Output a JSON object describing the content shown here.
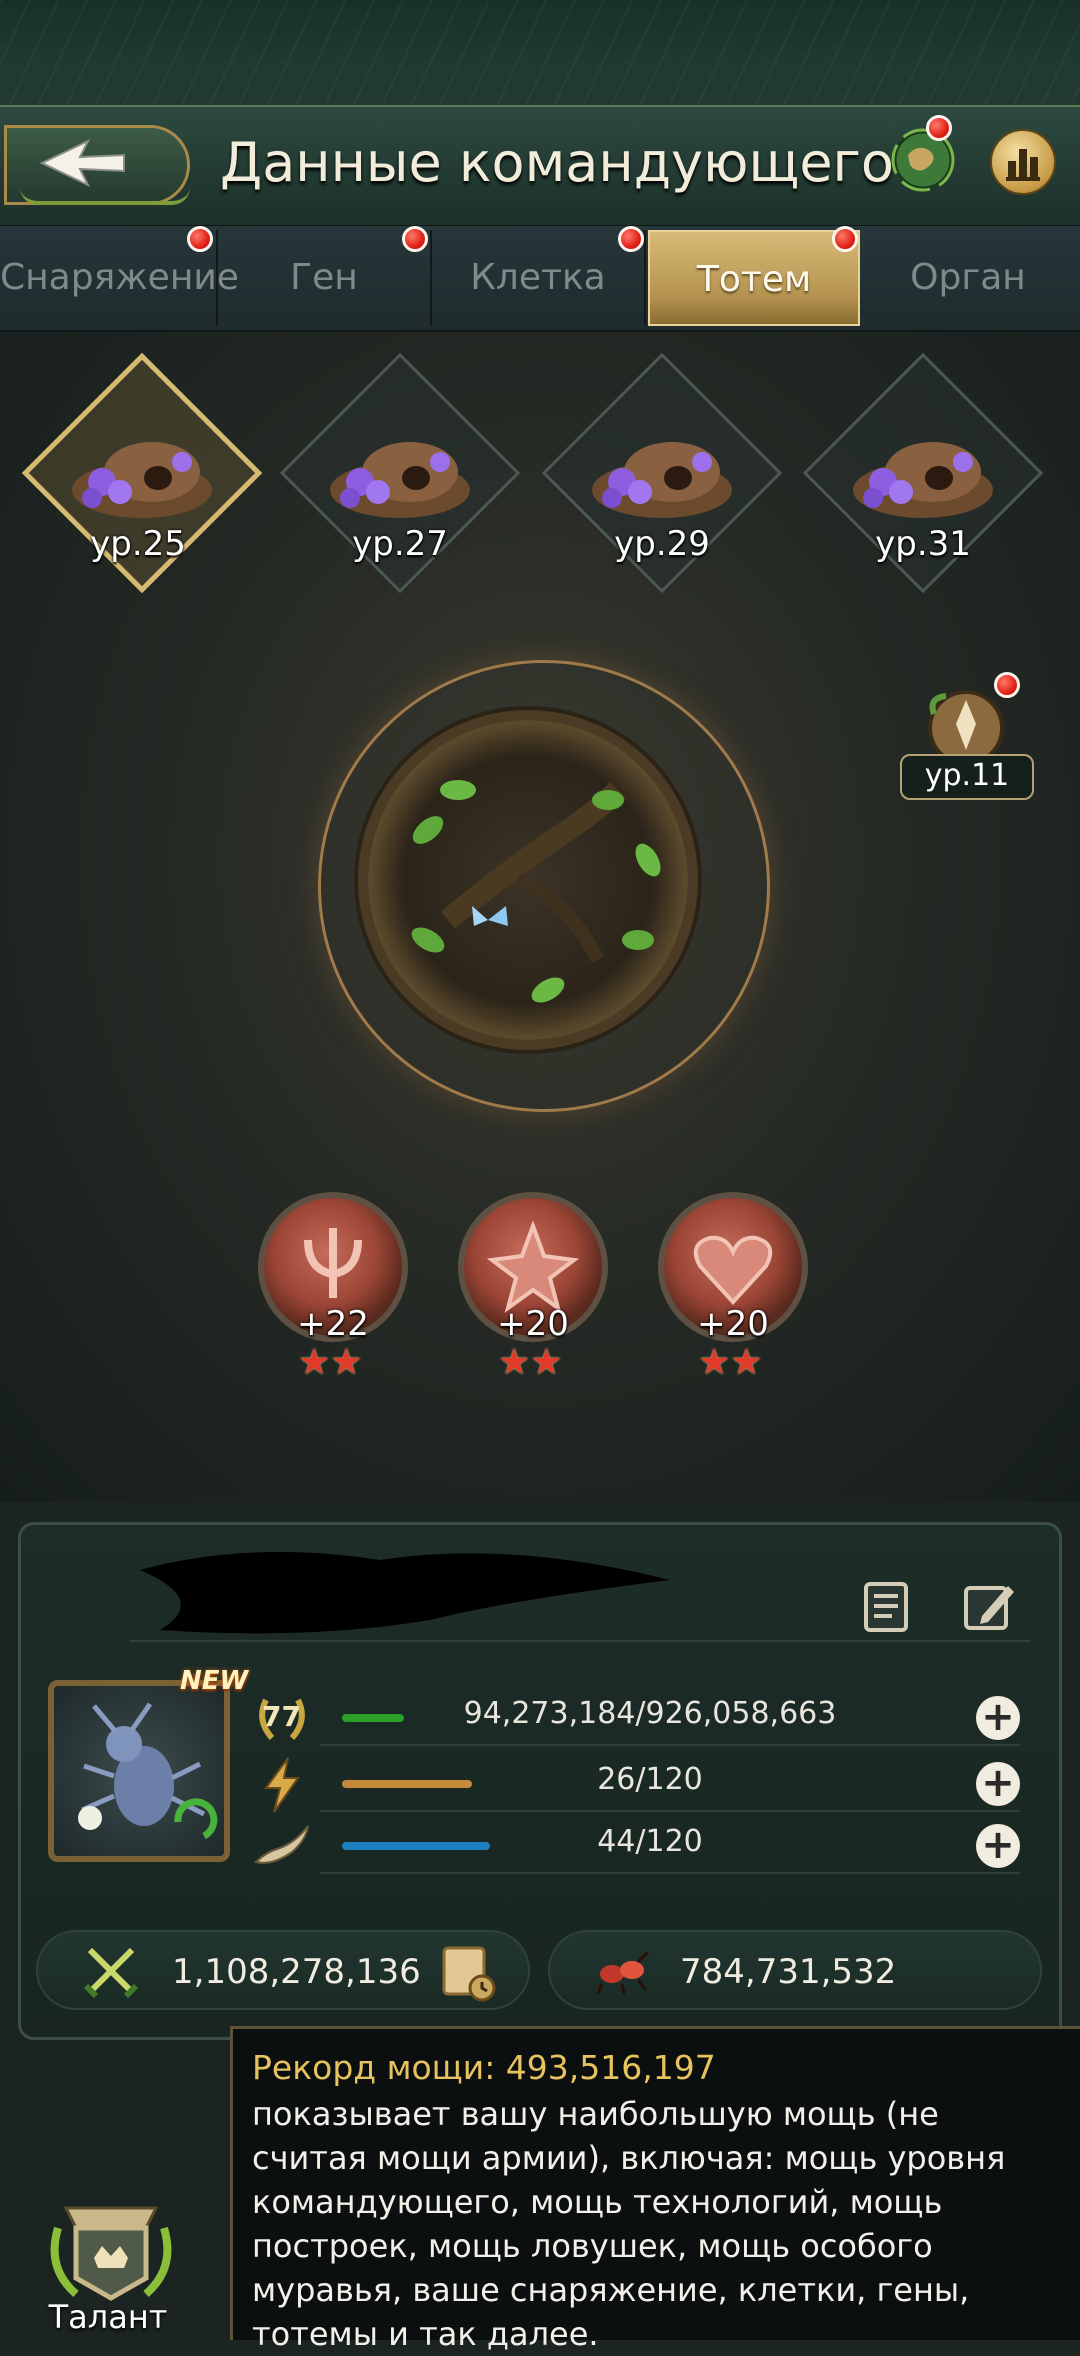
{
  "header": {
    "title": "Данные командующего"
  },
  "tabs": [
    {
      "label": "Снаряжение",
      "active": false,
      "notify": true
    },
    {
      "label": "Ген",
      "active": false,
      "notify": true
    },
    {
      "label": "Клетка",
      "active": false,
      "notify": true
    },
    {
      "label": "Тотем",
      "active": true,
      "notify": true
    },
    {
      "label": "Орган",
      "active": false,
      "notify": false
    }
  ],
  "totem_slots": [
    {
      "level": "ур.25",
      "selected": true
    },
    {
      "level": "ур.27",
      "selected": false
    },
    {
      "level": "ур.29",
      "selected": false
    },
    {
      "level": "ур.31",
      "selected": false
    }
  ],
  "side_badge": {
    "level": "ур.11"
  },
  "runes": [
    {
      "value": "+22",
      "stars": 2
    },
    {
      "value": "+20",
      "stars": 2
    },
    {
      "value": "+20",
      "stars": 2
    }
  ],
  "commander": {
    "new_badge": "NEW",
    "level": "77",
    "exp": "94,273,184/926,058,663",
    "exp_fraction": 0.102,
    "stamina": "26/120",
    "stamina_fraction": 0.217,
    "energy": "44/120",
    "energy_fraction": 0.367,
    "power": "1,108,278,136",
    "army_power": "784,731,532"
  },
  "tooltip": {
    "title": "Рекорд мощи: 493,516,197",
    "body": "показывает вашу наибольшую мощь (не считая мощи армии), включая: мощь уровня командующего, мощь технологий, мощь построек, мощь ловушек, мощь особого муравья, ваше снаряжение, клетки, гены, тотемы и так далее."
  },
  "talent": {
    "label": "Талант"
  },
  "colors": {
    "accent_gold": "#d6ba72",
    "exp_bar": "#2aa02a",
    "stamina_bar": "#c48a3a",
    "energy_bar": "#1e7fc2",
    "notify_red": "#e12218",
    "tooltip_title": "#e6c35f"
  }
}
